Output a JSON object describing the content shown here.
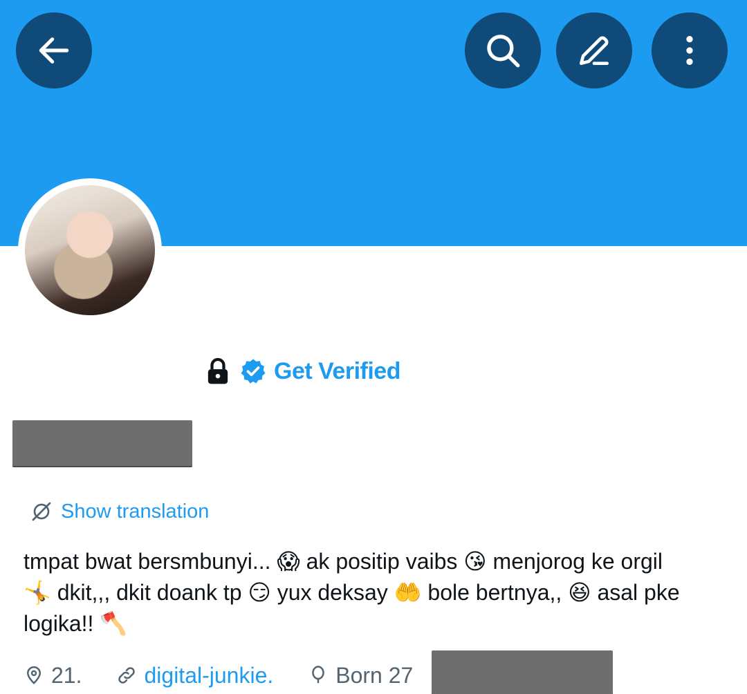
{
  "header": {
    "back_icon": "arrow-left-icon",
    "search_icon": "search-icon",
    "edit_icon": "pencil-icon",
    "more_icon": "more-vertical-icon",
    "banner_color": "#1d9bf0",
    "button_color": "#0f4a78"
  },
  "profile": {
    "lock_icon": "lock-icon",
    "verified_icon": "verified-badge-icon",
    "get_verified_label": "Get Verified",
    "accent": "#1d9bf0"
  },
  "translation": {
    "label": "Show translation"
  },
  "bio": {
    "line1": "tmpat bwat bersmbunyi... 😱 ak positip vaibs 😘 menjorog ke orgil",
    "line2": "🤸 dkit,,, dkit doank tp 😏 yux deksay 🤲 bole bertnya,, 😆 asal pke",
    "line3": "logika!! 🪓"
  },
  "meta": {
    "location": "21.",
    "website": "digital-junkie.",
    "born": "Born 27"
  }
}
